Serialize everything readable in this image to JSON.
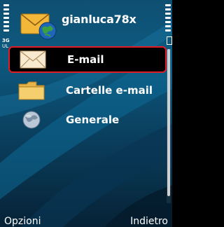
{
  "header": {
    "title": "gianluca78x",
    "app_icon": "mail-globe-icon",
    "network_type": "3G",
    "signal_mode": "UL"
  },
  "list": {
    "items": [
      {
        "label": "E-mail",
        "icon": "envelope-icon",
        "selected": true
      },
      {
        "label": "Cartelle e-mail",
        "icon": "folder-icon",
        "selected": false
      },
      {
        "label": "Generale",
        "icon": "globe-icon",
        "selected": false
      }
    ]
  },
  "softkeys": {
    "left": "Opzioni",
    "right": "Indietro"
  },
  "colors": {
    "selection_border": "#e11c24",
    "background_top": "#0f4f72",
    "background_bottom": "#062236"
  }
}
